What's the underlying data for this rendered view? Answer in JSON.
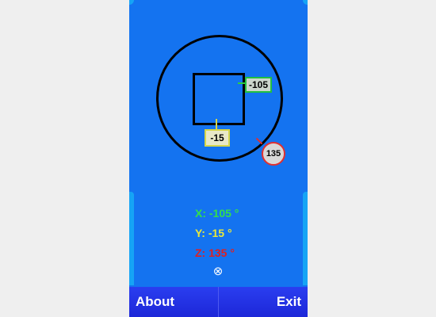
{
  "compass": {
    "x_value": "-105",
    "y_value": "-15",
    "z_value": "135"
  },
  "readouts": {
    "x": "X: -105 °",
    "y": "Y: -15 °",
    "z": "Z: 135 °"
  },
  "center_icon": "⊗",
  "softkeys": {
    "left": "About",
    "right": "Exit"
  },
  "colors": {
    "background": "#1473f0",
    "x_color": "#33e04a",
    "y_color": "#e8e83a",
    "z_color": "#e02020",
    "softbar": "#2a3ef0"
  }
}
